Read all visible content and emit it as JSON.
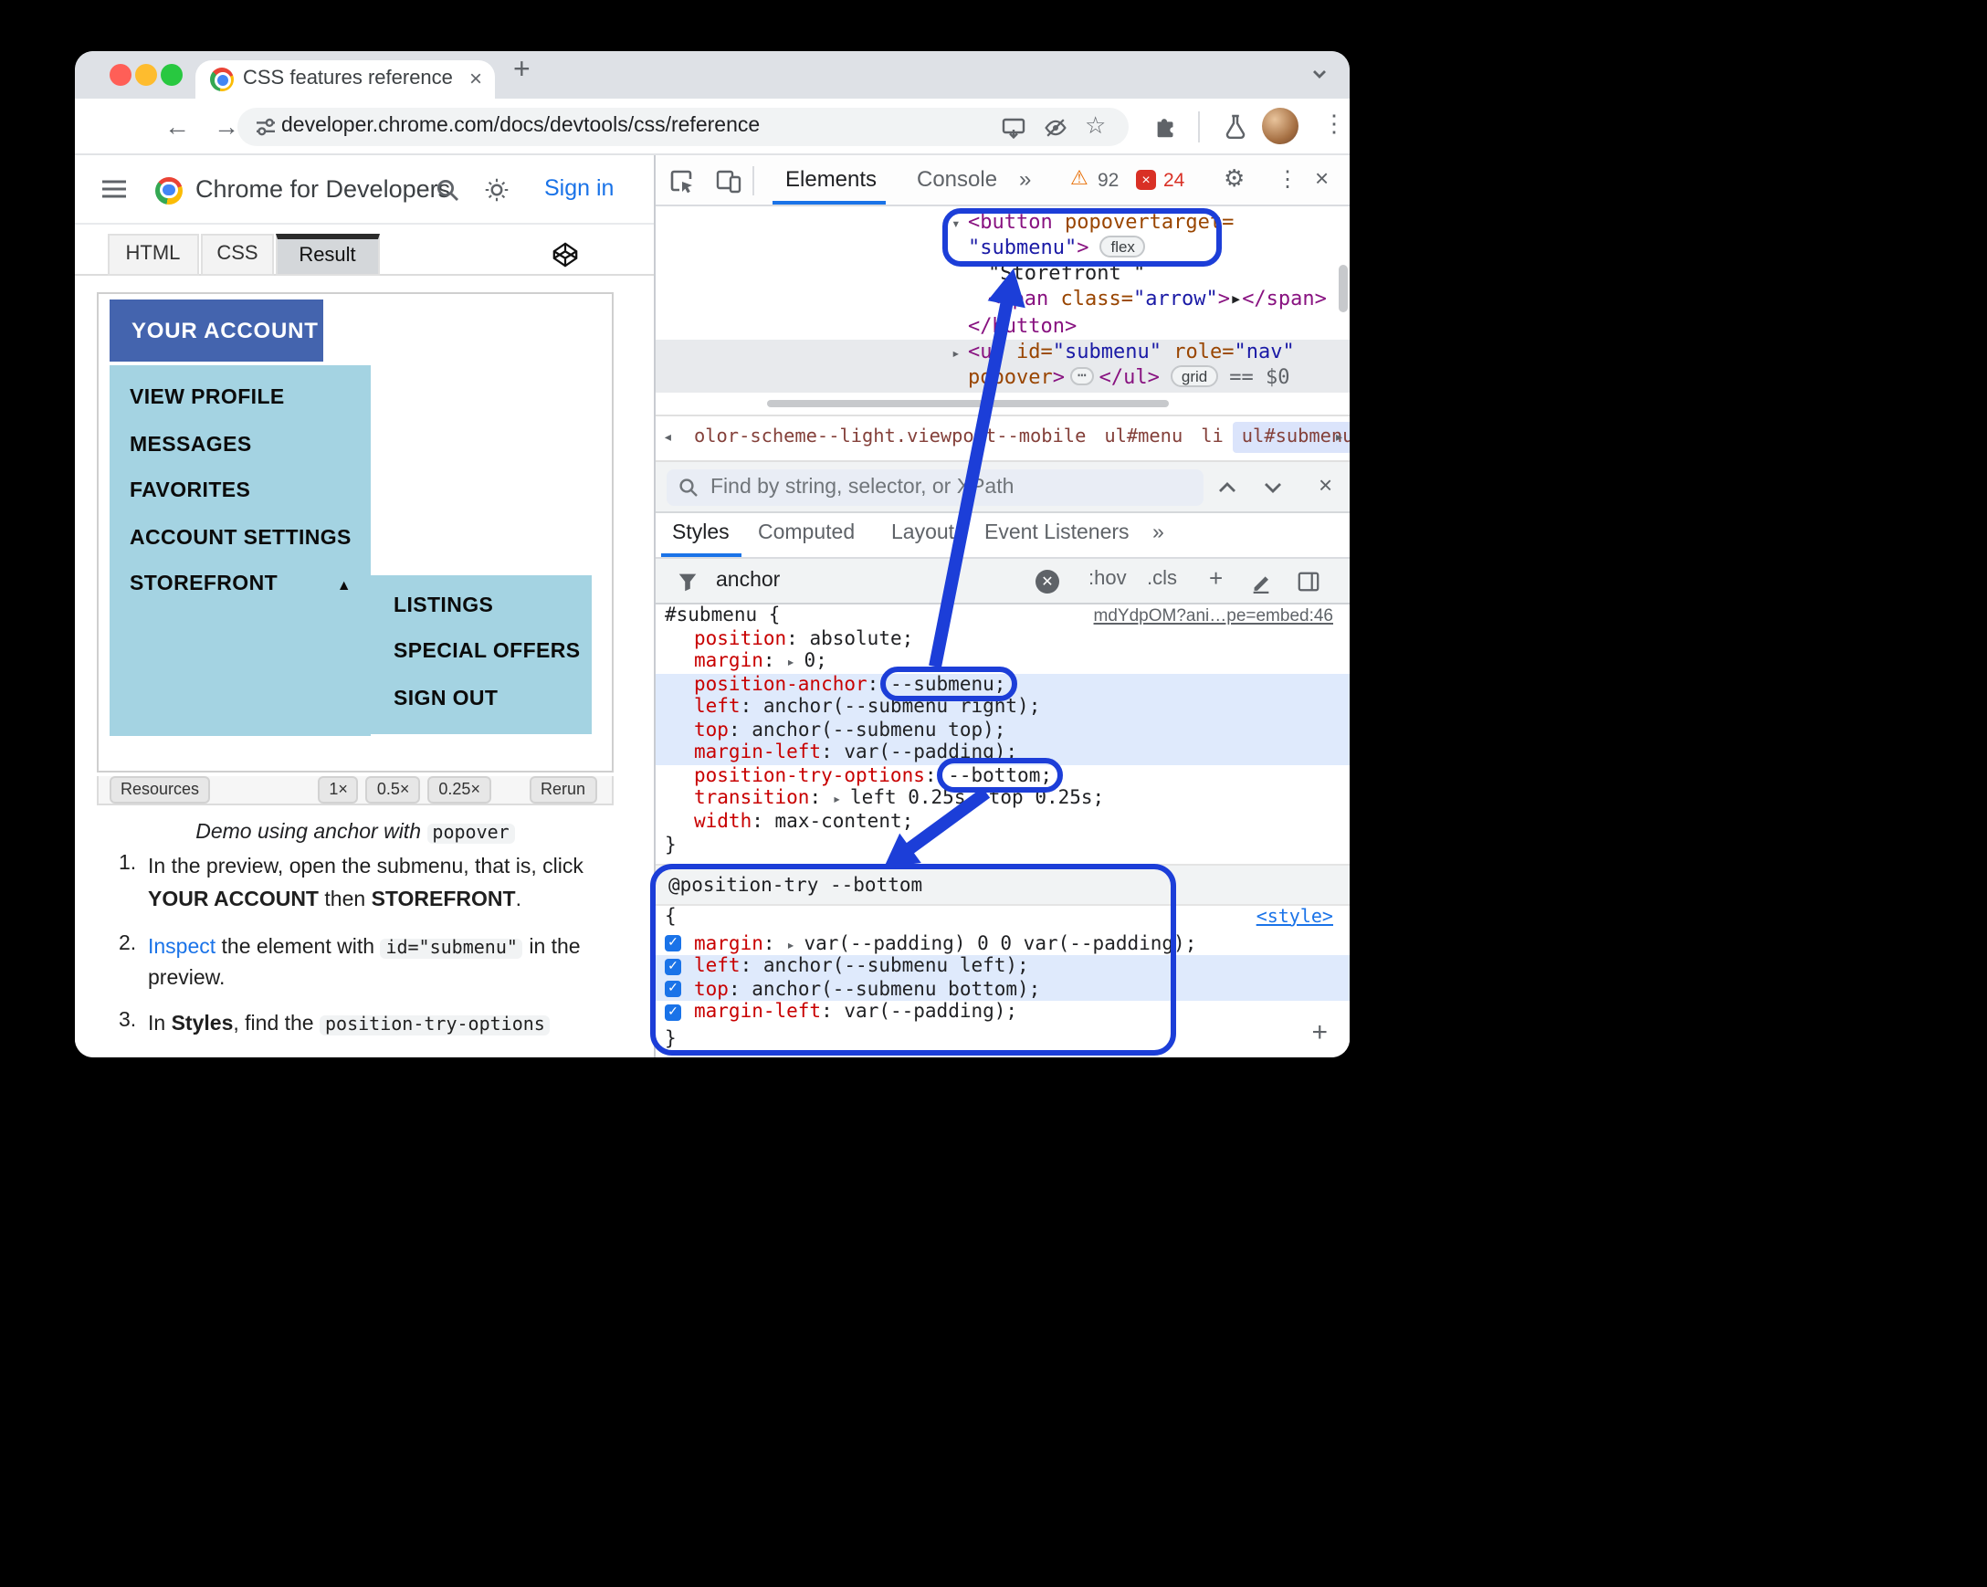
{
  "colors": {
    "annotation_blue": "#1c3ed8",
    "accent_blue": "#1a73e8",
    "account_button_blue": "#4464ae",
    "menu_panel_blue": "#a4d3e2"
  },
  "window": {
    "tab_title": "CSS features reference | Chr",
    "url": "developer.chrome.com/docs/devtools/css/reference"
  },
  "site": {
    "name": "Chrome for Developers",
    "sign_in": "Sign in"
  },
  "embed": {
    "tabs": [
      "HTML",
      "CSS",
      "Result"
    ],
    "active_tab": "Result",
    "account_button": "YOUR ACCOUNT",
    "submenu": [
      "VIEW PROFILE",
      "MESSAGES",
      "FAVORITES",
      "ACCOUNT SETTINGS",
      "STOREFRONT"
    ],
    "storefront_submenu": [
      "LISTINGS",
      "SPECIAL OFFERS",
      "SIGN OUT"
    ],
    "resources": "Resources",
    "zoom": [
      "1×",
      "0.5×",
      "0.25×"
    ],
    "rerun": "Rerun",
    "caption_text": "Demo using anchor with",
    "caption_code": "popover"
  },
  "steps": [
    {
      "num": "1.",
      "lines": [
        [
          {
            "t": "In the preview, open the submenu, that is, click"
          }
        ],
        [
          {
            "t": "YOUR ACCOUNT",
            "b": true
          },
          {
            "t": " then "
          },
          {
            "t": "STOREFRONT",
            "b": true
          },
          {
            "t": "."
          }
        ]
      ]
    },
    {
      "num": "2.",
      "lines": [
        [
          {
            "t": "Inspect",
            "link": true
          },
          {
            "t": " the element with "
          },
          {
            "t": "id=\"submenu\"",
            "code": true
          },
          {
            "t": " in the"
          }
        ],
        [
          {
            "t": "preview."
          }
        ]
      ]
    },
    {
      "num": "3.",
      "lines": [
        [
          {
            "t": "In "
          },
          {
            "t": "Styles",
            "b": true
          },
          {
            "t": ", find the "
          },
          {
            "t": "position-try-options",
            "code": true
          }
        ]
      ]
    }
  ],
  "devtools": {
    "tabs": [
      "Elements",
      "Console"
    ],
    "more_tabs": "»",
    "warnings": "92",
    "errors": "24",
    "tree": [
      {
        "arrow": "▾",
        "tokens": [
          [
            "tag",
            "<button"
          ],
          [
            "attr",
            " popovertarget="
          ]
        ]
      },
      {
        "tokens": [
          [
            "str",
            "\"submenu\""
          ],
          [
            "tag",
            ">"
          ]
        ],
        "badge": "flex"
      },
      {
        "indent": 1,
        "tokens": [
          [
            "txt",
            "\"Storefront \""
          ]
        ]
      },
      {
        "indent": 1,
        "tokens": [
          [
            "tag",
            "<span"
          ],
          [
            "attr",
            " class="
          ],
          [
            "str",
            "\"arrow\""
          ],
          [
            "tag",
            ">"
          ],
          [
            "txt",
            "▸"
          ],
          [
            "tag",
            "</span>"
          ]
        ]
      },
      {
        "tokens": [
          [
            "tag",
            "</button>"
          ]
        ]
      },
      {
        "arrow": "▸",
        "tokens": [
          [
            "tag",
            "<ul"
          ],
          [
            "attr",
            " id="
          ],
          [
            "str",
            "\"submenu\""
          ],
          [
            "attr",
            " role="
          ],
          [
            "str",
            "\"nav\""
          ]
        ],
        "selected": true
      },
      {
        "tokens": [
          [
            "attr",
            "popover"
          ],
          [
            "tag",
            ">"
          ]
        ],
        "dots": "⋯",
        "close": "</ul>",
        "badge": "grid",
        "suffix": "== $0",
        "selected": true
      }
    ],
    "breadcrumbs": [
      {
        "label": "olor-scheme--light.viewport--mobile"
      },
      {
        "label": "ul#menu"
      },
      {
        "label": "li"
      },
      {
        "label": "ul#submenu",
        "selected": true
      }
    ],
    "find_placeholder": "Find by string, selector, or XPath",
    "sidebar_tabs": [
      "Styles",
      "Computed",
      "Layout",
      "Event Listeners"
    ],
    "sidebar_more": "»",
    "filter_value": "anchor",
    "hov": ":hov",
    "cls": ".cls",
    "plus": "+",
    "rule": {
      "selector": "#submenu {",
      "source": "mdYdpOM?ani…pe=embed:46",
      "close": "}",
      "props": [
        {
          "name": "position",
          "value": "absolute;"
        },
        {
          "name": "margin",
          "arrow": true,
          "value": "0;"
        },
        {
          "name": "position-anchor",
          "value": "--submenu;",
          "hl": true
        },
        {
          "name": "left",
          "value": "anchor(--submenu right);",
          "hl": true
        },
        {
          "name": "top",
          "value": "anchor(--submenu top);",
          "hl": true
        },
        {
          "name": "margin-left",
          "value": "var(--padding);",
          "hl": true
        },
        {
          "name": "position-try-options",
          "value": "--bottom;"
        },
        {
          "name": "transition",
          "arrow": true,
          "value": "left 0.25s, top 0.25s;"
        },
        {
          "name": "width",
          "value": "max-content;"
        }
      ]
    },
    "position_try": {
      "header": "@position-try --bottom",
      "style_link": "<style>",
      "open": "{",
      "close": "}",
      "props": [
        {
          "name": "margin",
          "arrow": true,
          "value": "var(--padding) 0 0 var(--padding);",
          "checked": true
        },
        {
          "name": "left",
          "value": "anchor(--submenu left);",
          "checked": true,
          "hl": true
        },
        {
          "name": "top",
          "value": "anchor(--submenu bottom);",
          "checked": true,
          "hl": true
        },
        {
          "name": "margin-left",
          "value": "var(--padding);",
          "checked": true
        }
      ]
    }
  }
}
